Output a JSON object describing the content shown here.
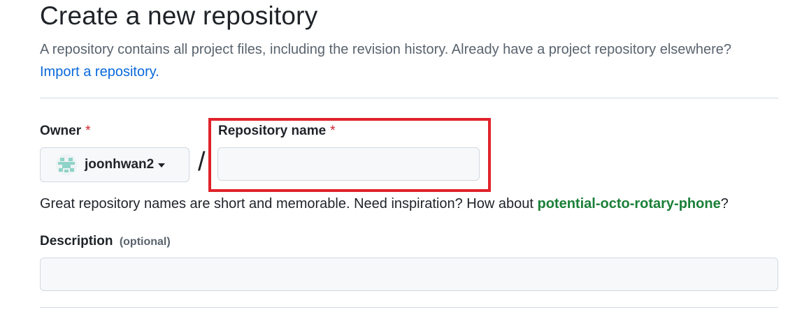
{
  "page": {
    "title": "Create a new repository",
    "intro_text": "A repository contains all project files, including the revision history. Already have a project repository elsewhere?",
    "import_link": "Import a repository."
  },
  "owner": {
    "label": "Owner",
    "required_mark": "*",
    "selected": "joonhwan2",
    "avatar_icon": "identicon-avatar"
  },
  "separator": "/",
  "repo_name": {
    "label": "Repository name",
    "required_mark": "*",
    "value": "",
    "placeholder": ""
  },
  "hint": {
    "text": "Great repository names are short and memorable. Need inspiration? How about",
    "suggestion": "potential-octo-rotary-phone",
    "end": "?"
  },
  "description": {
    "label": "Description",
    "optional": "(optional)",
    "value": "",
    "placeholder": ""
  },
  "colors": {
    "link": "#0969da",
    "required": "#d1242f",
    "suggestion": "#1a7f37",
    "highlight": "#e0222b"
  }
}
